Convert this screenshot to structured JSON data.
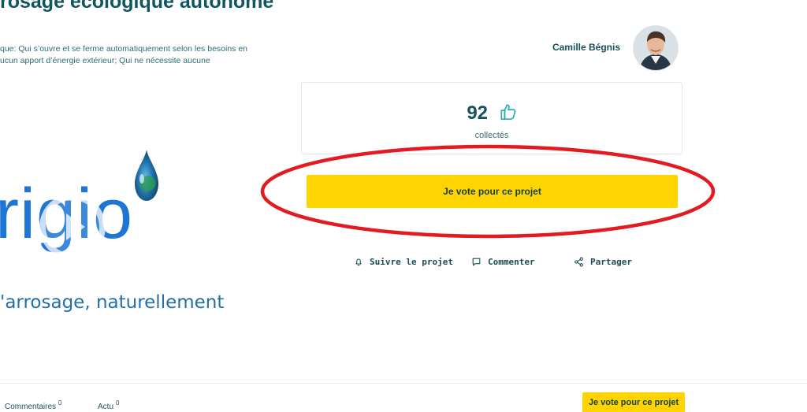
{
  "project": {
    "title_partial": "rosage écologique autonome",
    "description_lines": [
      "que: Qui s’ouvre et se ferme automatiquement selon les besoins en",
      "ucun apport d’énergie extérieur; Qui ne nécessite aucune"
    ]
  },
  "author": {
    "name": "Camille Bégnis"
  },
  "stats": {
    "count": "92",
    "count_label": "collectés"
  },
  "buttons": {
    "vote_main": "Je vote pour ce projet",
    "vote_footer": "Je vote pour ce projet"
  },
  "actions": {
    "follow": "Suivre le projet",
    "comment": "Commenter",
    "share": "Partager"
  },
  "logo": {
    "word": "rigio",
    "tagline": "'arrosage, naturellement"
  },
  "footer_tabs": {
    "comments_label": "Commentaires",
    "comments_count": "0",
    "news_label": "Actu",
    "news_count": "0"
  },
  "colors": {
    "accent_yellow": "#ffd400",
    "primary_teal": "#0f5660",
    "annotation_red": "#e21b23",
    "logo_blue": "#1d76d6"
  },
  "icons": {
    "like": "thumb-up-icon",
    "follow": "bell-icon",
    "comment": "chat-bubble-icon",
    "share": "share-icon",
    "play": "play-icon",
    "drop": "water-drop-icon"
  }
}
